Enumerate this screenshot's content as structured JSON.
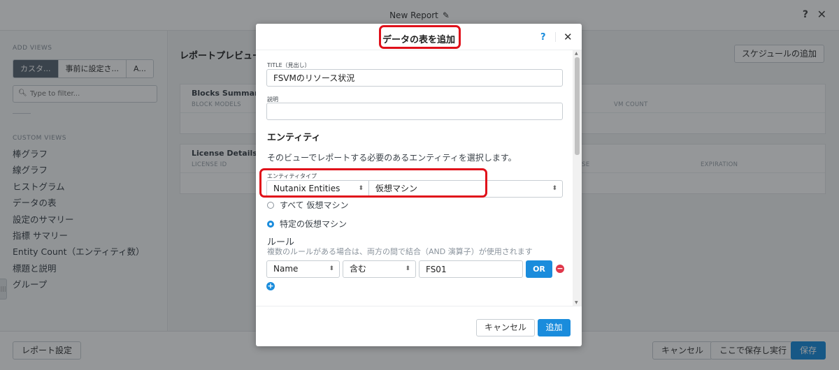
{
  "app": {
    "title": "New Report",
    "help": "?",
    "close": "✕",
    "left": {
      "title": "ADD VIEWS",
      "tabs": [
        "カスタ...",
        "事前に設定さ...",
        "A..."
      ],
      "filter_placeholder": "Type to filter...",
      "section": "CUSTOM VIEWS",
      "items": [
        "棒グラフ",
        "線グラフ",
        "ヒストグラム",
        "データの表",
        "設定のサマリー",
        "指標 サマリー",
        "Entity Count（エンティティ数）",
        "標題と説明",
        "グループ"
      ]
    },
    "main": {
      "title": "レポートプレビュー",
      "schedule_btn": "スケジュールの追加",
      "cards": [
        {
          "title": "Blocks Summary",
          "cols": [
            "BLOCK MODELS",
            "VM COUNT"
          ]
        },
        {
          "title": "License Details Tab",
          "cols": [
            "LICENSE ID",
            "SE",
            "EXPIRATION"
          ]
        }
      ]
    },
    "bottom": {
      "report_settings": "レポート設定",
      "cancel": "キャンセル",
      "save_run": "ここで保存し実行",
      "save": "保存"
    }
  },
  "modal": {
    "title": "データの表を追加",
    "help": "?",
    "close": "✕",
    "title_label": "TITLE（見出し）",
    "title_value": "FSVMのリソース状況",
    "desc_label": "説明",
    "desc_value": "",
    "entity_heading": "エンティティ",
    "entity_desc": "そのビューでレポートする必要のあるエンティティを選択します。",
    "entity_type_label": "エンティティタイプ",
    "entity_source": "Nutanix Entities",
    "entity_type": "仮想マシン",
    "radio_all": "すべて 仮想マシン",
    "radio_specific": "特定の仮想マシン",
    "radio_selected": "specific",
    "rules_title": "ルール",
    "rules_desc": "複数のルールがある場合は、両方の間で結合（AND 演算子）が使用されます",
    "rule": {
      "field": "Name",
      "operator": "含む",
      "value": "FS01",
      "or": "OR"
    },
    "cancel": "キャンセル",
    "add": "追加"
  },
  "colors": {
    "accent": "#1a8cdc",
    "annotation": "#e0101a",
    "remove": "#e0374a"
  }
}
